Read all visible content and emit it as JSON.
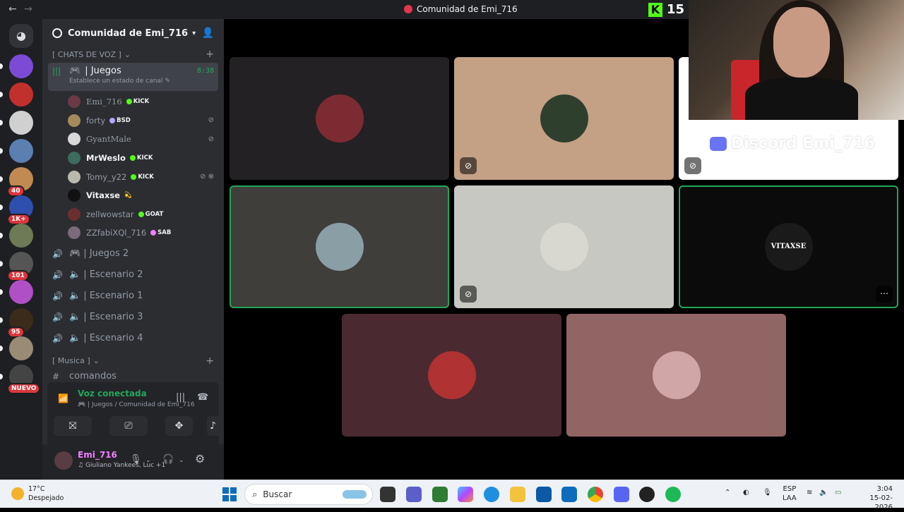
{
  "window": {
    "title": "Comunidad de Emi_716",
    "back": "←",
    "forward": "→",
    "kick_logo": "K",
    "kick_viewers": "15"
  },
  "guilds": [
    {
      "color": "#5865f2",
      "badge": ""
    },
    {
      "color": "#7b4bd6",
      "badge": ""
    },
    {
      "color": "#c2302e",
      "badge": ""
    },
    {
      "color": "#d0d0d0",
      "badge": ""
    },
    {
      "color": "#5a7fb0",
      "badge": ""
    },
    {
      "color": "#c08a52",
      "badge": "40"
    },
    {
      "color": "#2e4fae",
      "badge": "1K+"
    },
    {
      "color": "#6d7a55",
      "badge": ""
    },
    {
      "color": "#555555",
      "badge": "101"
    },
    {
      "color": "#b04fc6",
      "badge": ""
    },
    {
      "color": "#3a2b1a",
      "badge": "95"
    },
    {
      "color": "#9a8b77",
      "badge": ""
    },
    {
      "color": "#444444",
      "badge": "NUEVO"
    }
  ],
  "server": {
    "name": "Comunidad de Emi_716",
    "category_voice": "[ CHATS DE VOZ ]",
    "active_channel": {
      "name": "| Juegos",
      "timer": "8:38",
      "status": "Establece un estado de canal"
    },
    "members": [
      {
        "name": "Emi_716",
        "tag": "KICK",
        "tag_color": "#53fc18",
        "avatar": "#6b3a44",
        "bold": false,
        "muted": "",
        "name_style": "serif"
      },
      {
        "name": "forty",
        "tag": "BSD",
        "tag_color": "#b6a6ff",
        "avatar": "#a58a5c",
        "bold": false,
        "muted": "mic-off",
        "name_style": ""
      },
      {
        "name": "GyantMale",
        "tag": "",
        "tag_color": "",
        "avatar": "#d9d9d9",
        "bold": false,
        "muted": "mic-off",
        "name_style": "serif"
      },
      {
        "name": "MrWeslo",
        "tag": "KICK",
        "tag_color": "#53fc18",
        "avatar": "#3b6c5c",
        "bold": true,
        "muted": "",
        "name_style": ""
      },
      {
        "name": "Tomy_y22",
        "tag": "KICK",
        "tag_color": "#53fc18",
        "avatar": "#b9b9ae",
        "bold": false,
        "muted": "mic-off deafened",
        "name_style": ""
      },
      {
        "name": "Vitaxse",
        "tag": "💫",
        "tag_color": "",
        "avatar": "#111111",
        "bold": true,
        "muted": "",
        "name_style": ""
      },
      {
        "name": "zellwowstar",
        "tag": "GOAT",
        "tag_color": "#53fc18",
        "avatar": "#6b2f2f",
        "bold": false,
        "muted": "",
        "name_style": ""
      },
      {
        "name": "ZZfabiXQl_716",
        "tag": "SAB",
        "tag_color": "#f47fff",
        "avatar": "#7a6a7a",
        "bold": false,
        "muted": "",
        "name_style": ""
      }
    ],
    "voice_channels": [
      "| Juegos 2",
      "| Escenario 2",
      "| Escenario 1",
      "| Escenario 3",
      "| Escenario 4"
    ],
    "category_music": "[ Musica ]",
    "text_channel": "comandos"
  },
  "voice_panel": {
    "title": "Voz conectada",
    "subtitle": "| Juegos / Comunidad de Emi_716"
  },
  "user_panel": {
    "name": "Emi_716",
    "activity": "Giuliano Yankees, Luc +1"
  },
  "tiles": [
    {
      "bg": "#232124",
      "avatar": "#7d2b33",
      "muted": false,
      "speaking": false
    },
    {
      "bg": "#c4a084",
      "avatar": "#2f3f2e",
      "muted": true,
      "speaking": false
    },
    {
      "bg": "#ffffff",
      "avatar": "#222222",
      "muted": true,
      "speaking": false,
      "watermark": "Discord Emi_716"
    },
    {
      "bg": "#3f3e3a",
      "avatar": "#8a9ea6",
      "muted": false,
      "speaking": true
    },
    {
      "bg": "#c8c8c2",
      "avatar": "#d8d8d0",
      "muted": true,
      "speaking": false
    },
    {
      "bg": "#0b0b0b",
      "avatar": "#1a1a1a",
      "muted": false,
      "speaking": true,
      "label": "VITAXSE"
    },
    {
      "bg": "#4a2a30",
      "avatar": "#b03232",
      "muted": false,
      "speaking": false
    },
    {
      "bg": "#926565",
      "avatar": "#d0a6a6",
      "muted": false,
      "speaking": false
    }
  ],
  "taskbar": {
    "temp": "17°C",
    "weather": "Despejado",
    "search_placeholder": "Buscar",
    "lang1": "ESP",
    "lang2": "LAA",
    "time": "3:04",
    "date": "15-02-2026"
  }
}
